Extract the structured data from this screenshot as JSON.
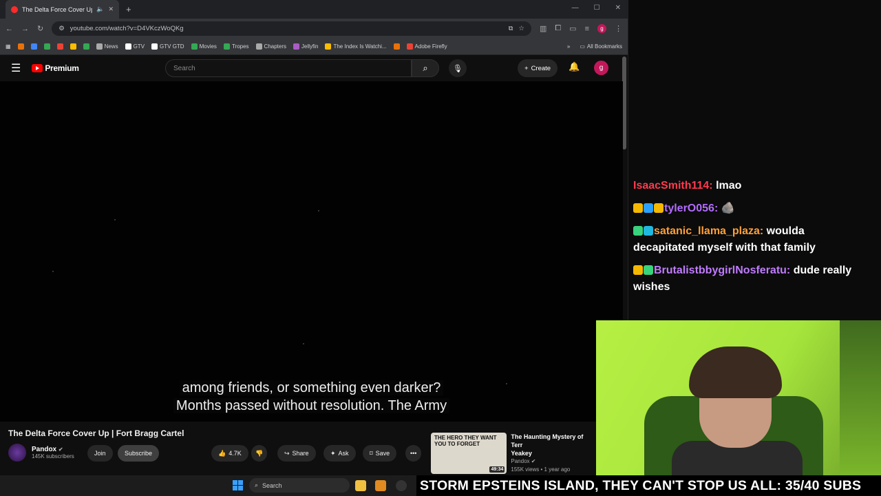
{
  "browser": {
    "tab_title": "The Delta Force Cover Up |",
    "url": "youtube.com/watch?v=D4VKczWoQKg",
    "bookmarks": [
      {
        "label": "",
        "color": "#e8710a"
      },
      {
        "label": "",
        "color": "#4285f4"
      },
      {
        "label": "",
        "color": "#34a853"
      },
      {
        "label": "",
        "color": "#ea4335"
      },
      {
        "label": "",
        "color": "#fbbc04"
      },
      {
        "label": "",
        "color": "#34a853"
      },
      {
        "label": "News",
        "color": "#aaaaaa"
      },
      {
        "label": "GTV",
        "color": "#ffffff"
      },
      {
        "label": "GTV GTD",
        "color": "#ffffff"
      },
      {
        "label": "Movies",
        "color": "#34a853"
      },
      {
        "label": "Tropes",
        "color": "#34a853"
      },
      {
        "label": "Chapters",
        "color": "#aaaaaa"
      },
      {
        "label": "Jellyfin",
        "color": "#aa5cc3"
      },
      {
        "label": "The Index Is Watchi...",
        "color": "#fbbc04"
      },
      {
        "label": "",
        "color": "#e8710a"
      },
      {
        "label": "Adobe Firefly",
        "color": "#ea4335"
      }
    ],
    "all_bookmarks": "All Bookmarks"
  },
  "youtube": {
    "logo_text": "Premium",
    "search_placeholder": "Search",
    "create_label": "Create",
    "avatar_letter": "g",
    "subtitle_line1": "among friends, or something even darker?",
    "subtitle_line2": "Months passed without resolution. The Army",
    "video_title": "The Delta Force Cover Up | Fort Bragg Cartel",
    "channel_name": "Pandox",
    "channel_subs": "145K subscribers",
    "join_label": "Join",
    "subscribe_label": "Subscribe",
    "like_count": "4.7K",
    "share_label": "Share",
    "ask_label": "Ask",
    "save_label": "Save",
    "rec_title": "The Haunting Mystery of Terr",
    "rec_title2": "Yeakey",
    "rec_channel": "Pandox",
    "rec_meta": "155K views • 1 year ago",
    "rec_thumb_text": "THE HERO THEY WANT YOU TO FORGET",
    "rec_duration": "49:34"
  },
  "chat": [
    {
      "user": "IsaacSmith114:",
      "text": "lmao",
      "color": "#ff3b4e",
      "badges": []
    },
    {
      "user": "tylerO056:",
      "text": "",
      "color": "#b36cff",
      "badges": [
        "#f5b800",
        "#2aa0ff",
        "#f5b800"
      ]
    },
    {
      "user": "satanic_llama_plaza:",
      "text": "woulda decapitated myself with that family",
      "color": "#ff9f3a",
      "badges": [
        "#38d37c",
        "#20b8e0"
      ]
    },
    {
      "user": "BrutalistbbygirlNosferatu:",
      "text": "dude really wishes",
      "color": "#c07cff",
      "badges": [
        "#f5b800",
        "#38d37c"
      ]
    }
  ],
  "taskbar": {
    "search_placeholder": "Search"
  },
  "stream_banner": "STORM EPSTEINS ISLAND, THEY CAN'T STOP US ALL: 35/40 SUBS"
}
